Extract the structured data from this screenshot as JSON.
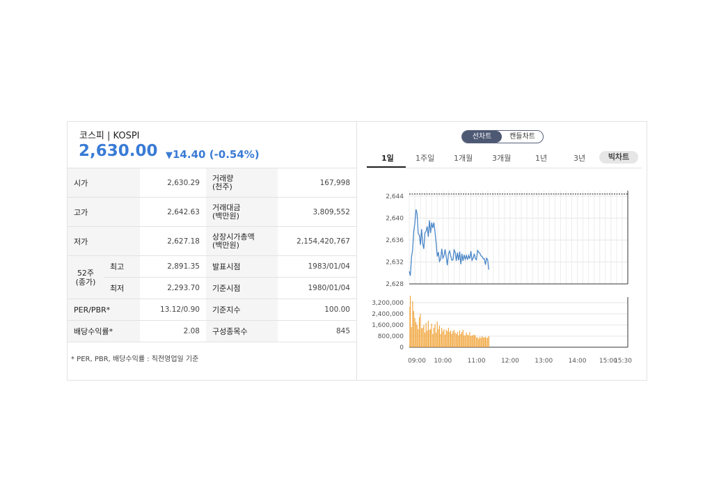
{
  "header": {
    "title": "코스피 | KOSPI",
    "price": "2,630.00",
    "change_arrow": "▼",
    "change_value": "14.40",
    "change_pct": "(-0.54%)"
  },
  "table": {
    "open_label": "시가",
    "open_value": "2,630.29",
    "volume_label": "거래량\n(천주)",
    "volume_value": "167,998",
    "high_label": "고가",
    "high_value": "2,642.63",
    "amount_label": "거래대금\n(백만원)",
    "amount_value": "3,809,552",
    "low_label": "저가",
    "low_value": "2,627.18",
    "mktcap_label": "상장시가총액\n(백만원)",
    "mktcap_value": "2,154,420,767",
    "wk52_label": "52주\n(종가)",
    "wk52_high_label": "최고",
    "wk52_high_value": "2,891.35",
    "announce_label": "발표시점",
    "announce_value": "1983/01/04",
    "wk52_low_label": "최저",
    "wk52_low_value": "2,293.70",
    "base_date_label": "기준시점",
    "base_date_value": "1980/01/04",
    "per_label": "PER/PBR*",
    "per_value": "13.12/0.90",
    "base_index_label": "기준지수",
    "base_index_value": "100.00",
    "dividend_label": "배당수익률*",
    "dividend_value": "2.08",
    "constituents_label": "구성종목수",
    "constituents_value": "845",
    "note": "* PER, PBR, 배당수익률 : 직전영업일 기준"
  },
  "chart_controls": {
    "toggle_line": "선차트",
    "toggle_candle": "캔들차트",
    "tabs": [
      "1일",
      "1주일",
      "1개월",
      "3개월",
      "1년",
      "3년"
    ],
    "active_tab": "1일",
    "bar_chart_button": "빅차트"
  },
  "colors": {
    "accent": "#3a7bd5",
    "line": "#4a86c7",
    "bar": "#f0a030",
    "toggle_on": "#4d5873"
  },
  "chart_data": [
    {
      "type": "line",
      "x_ticks": [
        "09:00",
        "10:00",
        "11:00",
        "12:00",
        "13:00",
        "14:00",
        "15:00",
        "15:30"
      ],
      "y_ticks": [
        "2,628",
        "2,632",
        "2,636",
        "2,640",
        "2,644"
      ],
      "ylim": [
        2628,
        2644
      ],
      "reference_line": 2644.4,
      "series": [
        {
          "x": [
            "09:00",
            "09:02",
            "09:04",
            "09:06",
            "09:08",
            "09:10",
            "09:12",
            "09:14",
            "09:16",
            "09:18",
            "09:20",
            "09:22",
            "09:24",
            "09:26",
            "09:28",
            "09:30",
            "09:32",
            "09:34",
            "09:36",
            "09:38",
            "09:40",
            "09:42",
            "09:44",
            "09:46",
            "09:48",
            "09:50",
            "09:52",
            "09:54",
            "09:56",
            "09:58",
            "10:00",
            "10:02",
            "10:04",
            "10:06",
            "10:08",
            "10:10",
            "10:12",
            "10:14",
            "10:16",
            "10:18",
            "10:20",
            "10:22",
            "10:24",
            "10:26",
            "10:28",
            "10:30",
            "10:32",
            "10:34",
            "10:36",
            "10:38",
            "10:40",
            "10:42",
            "10:44",
            "10:46",
            "10:48",
            "10:50",
            "10:52",
            "10:54",
            "10:56",
            "10:58",
            "11:00",
            "11:02",
            "11:04",
            "11:06",
            "11:08",
            "11:10",
            "11:12",
            "11:14",
            "11:16",
            "11:18",
            "11:20",
            "11:22"
          ],
          "values": [
            2630.29,
            2629.5,
            2632.8,
            2634.2,
            2637.5,
            2639.1,
            2641.6,
            2640.8,
            2637.2,
            2636.9,
            2635.1,
            2638.0,
            2635.4,
            2634.4,
            2637.3,
            2637.6,
            2638.5,
            2636.6,
            2639.6,
            2637.3,
            2639.2,
            2638.2,
            2639.2,
            2637.5,
            2635.5,
            2633.0,
            2633.8,
            2632.1,
            2632.5,
            2634.4,
            2632.7,
            2633.1,
            2634.3,
            2633.0,
            2631.4,
            2633.5,
            2634.0,
            2633.1,
            2632.3,
            2632.4,
            2634.2,
            2633.8,
            2632.2,
            2633.7,
            2632.3,
            2633.9,
            2631.6,
            2633.5,
            2632.2,
            2633.3,
            2632.5,
            2633.2,
            2632.4,
            2633.2,
            2632.6,
            2634.0,
            2632.3,
            2632.7,
            2633.5,
            2632.6,
            2632.4,
            2634.1,
            2633.8,
            2633.6,
            2633.1,
            2633.0,
            2632.6,
            2632.6,
            2631.5,
            2632.7,
            2632.4,
            2630.6
          ]
        }
      ]
    },
    {
      "type": "bar",
      "y_ticks": [
        "0",
        "800,000",
        "1,600,000",
        "2,400,000",
        "3,200,000"
      ],
      "ylim": [
        0,
        3200000
      ],
      "values": [
        2900000,
        3750000,
        1450000,
        3300000,
        2600000,
        2100000,
        1800000,
        1600000,
        1300000,
        2150000,
        2400000,
        1350000,
        1400000,
        1600000,
        1050000,
        1750000,
        1200000,
        1900000,
        1250000,
        1300000,
        1700000,
        950000,
        1400000,
        1650000,
        1050000,
        1850000,
        1300000,
        1550000,
        950000,
        1400000,
        1150000,
        1300000,
        900000,
        1250000,
        1150000,
        1400000,
        1100000,
        1200000,
        950000,
        1150000,
        1250000,
        1050000,
        950000,
        1100000,
        850000,
        1200000,
        950000,
        1100000,
        1250000,
        850000,
        850000,
        1050000,
        900000,
        850000,
        1100000,
        800000,
        850000,
        850000,
        900000,
        850000,
        700000,
        700000,
        600000,
        750000,
        650000,
        800000,
        700000,
        700000,
        750000,
        650000,
        700000,
        800000
      ]
    }
  ]
}
